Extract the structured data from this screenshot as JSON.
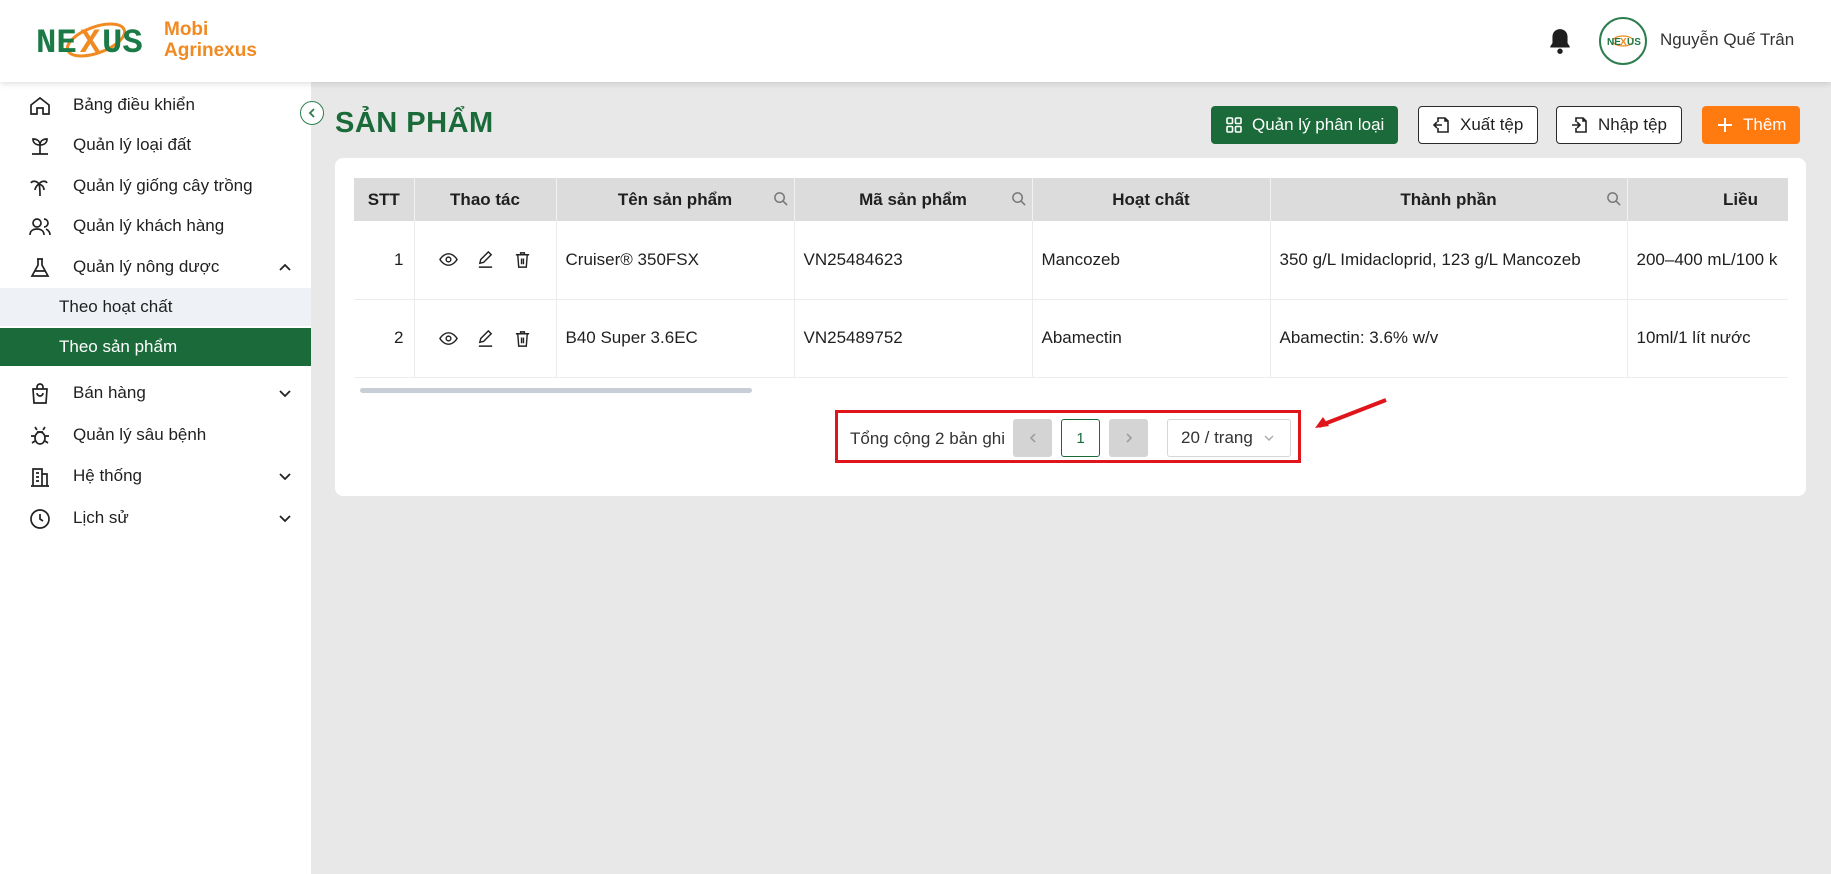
{
  "brand": {
    "line1": "Mobi",
    "line2": "Agrinexus"
  },
  "user": {
    "name": "Nguyễn Quế Trân"
  },
  "sidebar": {
    "items": [
      {
        "label": "Bảng điều khiển"
      },
      {
        "label": "Quản lý loại đất"
      },
      {
        "label": "Quản lý giống cây trồng"
      },
      {
        "label": "Quản lý khách hàng"
      },
      {
        "label": "Quản lý nông dược"
      },
      {
        "label": "Bán hàng"
      },
      {
        "label": "Quản lý sâu bệnh"
      },
      {
        "label": "Hệ thống"
      },
      {
        "label": "Lịch sử"
      }
    ],
    "subitems": [
      {
        "label": "Theo hoạt chất"
      },
      {
        "label": "Theo sản phẩm"
      }
    ]
  },
  "page": {
    "title": "SẢN PHẨM"
  },
  "toolbar": {
    "manage_label": "Quản lý phân loại",
    "export_label": "Xuất tệp",
    "import_label": "Nhập tệp",
    "add_label": "Thêm"
  },
  "table": {
    "columns": [
      "STT",
      "Thao tác",
      "Tên sản phẩm",
      "Mã sản phẩm",
      "Hoạt chất",
      "Thành phần",
      "Liều"
    ],
    "rows": [
      {
        "stt": "1",
        "name": "Cruiser® 350FSX",
        "code": "VN25484623",
        "active": "Mancozeb",
        "composition": "350 g/L Imidacloprid, 123 g/L Mancozeb",
        "dose": "200–400 mL/100 k"
      },
      {
        "stt": "2",
        "name": "B40 Super 3.6EC",
        "code": "VN25489752",
        "active": "Abamectin",
        "composition": "Abamectin: 3.6% w/v",
        "dose": "10ml/1 lít nước"
      }
    ]
  },
  "pagination": {
    "total_text": "Tổng cộng 2 bản ghi",
    "current_page": "1",
    "page_size": "20 / trang"
  },
  "colors": {
    "primary": "#1b6b3a",
    "accent": "#ff7a0f",
    "highlight": "#e0141b"
  }
}
